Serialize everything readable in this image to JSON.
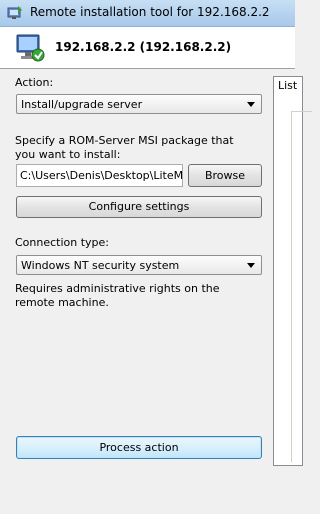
{
  "window": {
    "title": "Remote installation tool for 192.168.2.2"
  },
  "header": {
    "host_title": "192.168.2.2 (192.168.2.2)"
  },
  "action": {
    "label": "Action:",
    "selected": "Install/upgrade server"
  },
  "msi": {
    "prompt": "Specify a ROM-Server MSI package that you want to install:",
    "path_value": "C:\\Users\\Denis\\Desktop\\LiteMana",
    "browse_label": "Browse"
  },
  "configure_label": "Configure settings",
  "connection": {
    "label": "Connection type:",
    "selected": "Windows NT security system",
    "note": "Requires administrative rights on the remote machine."
  },
  "process_label": "Process action",
  "right_panel": {
    "tab_label": "List"
  },
  "icons": {
    "app": "installer-icon",
    "host": "computer-install-icon"
  }
}
